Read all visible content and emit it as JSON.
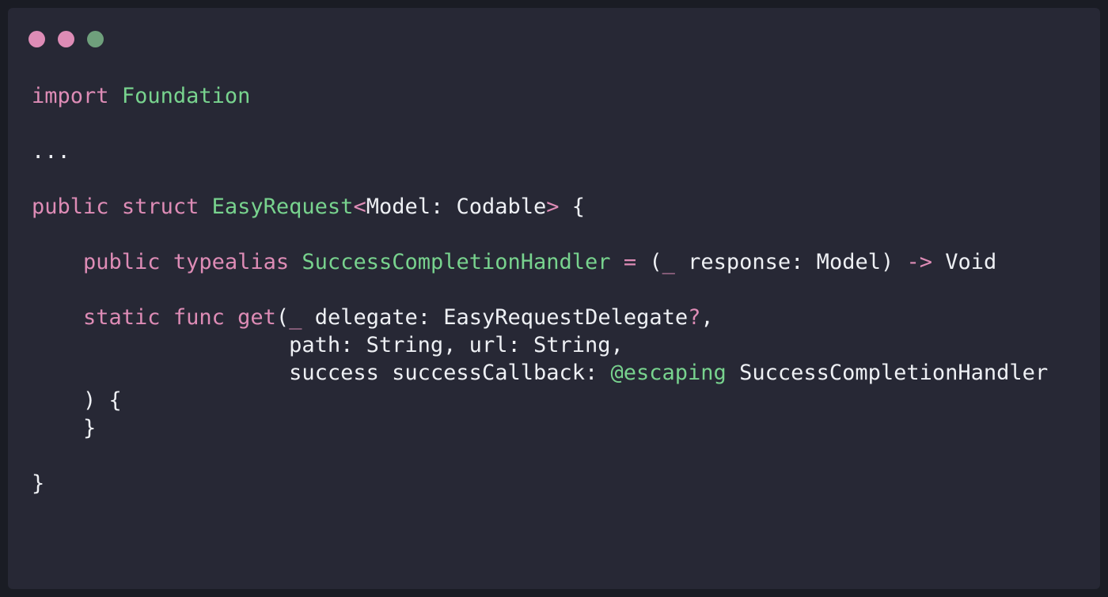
{
  "colors": {
    "page_bg": "#1a1c24",
    "window_bg": "#272835",
    "keyword": "#de8cb6",
    "type": "#78d38e",
    "text": "#eef0f4"
  },
  "window_controls": [
    {
      "name": "close-dot",
      "color": "#de8cb6"
    },
    {
      "name": "minimize-dot",
      "color": "#de8cb6"
    },
    {
      "name": "zoom-dot",
      "color": "#6fa07c"
    }
  ],
  "code_lines": [
    [
      {
        "text": "import",
        "kind": "keyword"
      },
      {
        "text": " ",
        "kind": "text"
      },
      {
        "text": "Foundation",
        "kind": "type"
      }
    ],
    [],
    [
      {
        "text": "...",
        "kind": "text"
      }
    ],
    [],
    [
      {
        "text": "public",
        "kind": "keyword"
      },
      {
        "text": " ",
        "kind": "text"
      },
      {
        "text": "struct",
        "kind": "keyword"
      },
      {
        "text": " ",
        "kind": "text"
      },
      {
        "text": "EasyRequest",
        "kind": "type"
      },
      {
        "text": "<",
        "kind": "keyword"
      },
      {
        "text": "Model: Codable",
        "kind": "text"
      },
      {
        "text": ">",
        "kind": "keyword"
      },
      {
        "text": " {",
        "kind": "text"
      }
    ],
    [],
    [
      {
        "text": "    ",
        "kind": "text"
      },
      {
        "text": "public",
        "kind": "keyword"
      },
      {
        "text": " ",
        "kind": "text"
      },
      {
        "text": "typealias",
        "kind": "keyword"
      },
      {
        "text": " ",
        "kind": "text"
      },
      {
        "text": "SuccessCompletionHandler",
        "kind": "type"
      },
      {
        "text": " ",
        "kind": "text"
      },
      {
        "text": "=",
        "kind": "keyword"
      },
      {
        "text": " (",
        "kind": "text"
      },
      {
        "text": "_",
        "kind": "keyword"
      },
      {
        "text": " response: Model) ",
        "kind": "text"
      },
      {
        "text": "->",
        "kind": "keyword"
      },
      {
        "text": " Void",
        "kind": "text"
      }
    ],
    [],
    [
      {
        "text": "    ",
        "kind": "text"
      },
      {
        "text": "static",
        "kind": "keyword"
      },
      {
        "text": " ",
        "kind": "text"
      },
      {
        "text": "func",
        "kind": "keyword"
      },
      {
        "text": " ",
        "kind": "text"
      },
      {
        "text": "get",
        "kind": "keyword"
      },
      {
        "text": "(",
        "kind": "text"
      },
      {
        "text": "_",
        "kind": "keyword"
      },
      {
        "text": " delegate: EasyRequestDelegate",
        "kind": "text"
      },
      {
        "text": "?",
        "kind": "keyword"
      },
      {
        "text": ",",
        "kind": "text"
      }
    ],
    [
      {
        "text": "                    path: String, url: String,",
        "kind": "text"
      }
    ],
    [
      {
        "text": "                    success successCallback: ",
        "kind": "text"
      },
      {
        "text": "@escaping",
        "kind": "type"
      },
      {
        "text": " SuccessCompletionHandler",
        "kind": "text"
      }
    ],
    [
      {
        "text": "    ) {",
        "kind": "text"
      }
    ],
    [
      {
        "text": "    }",
        "kind": "text"
      }
    ],
    [],
    [
      {
        "text": "}",
        "kind": "text"
      }
    ]
  ]
}
